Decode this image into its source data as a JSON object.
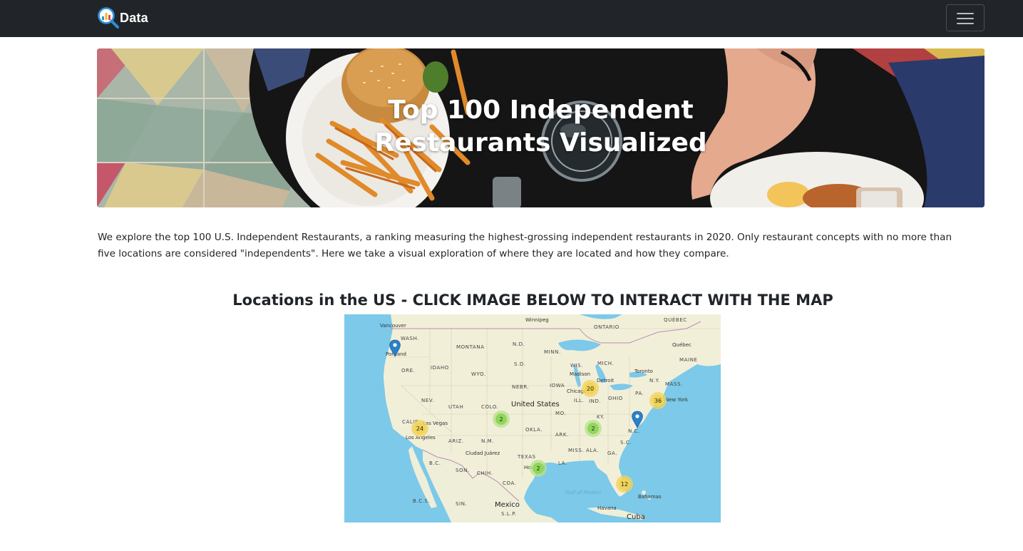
{
  "navbar": {
    "brand_text": "Data",
    "logo_icon": "magnifier-chart-icon",
    "toggler_icon": "hamburger-menu-icon"
  },
  "hero": {
    "title": "Top 100 Independent Restaurants Visualized"
  },
  "intro": {
    "text": "We explore the top 100 U.S. Independent Restaurants, a ranking measuring the highest-grossing independent restaurants in 2020. Only restaurant concepts with no more than five locations are considered \"independents\". Here we take a visual exploration of where they are located and how they compare."
  },
  "map_section": {
    "heading": "Locations in the US - CLICK IMAGE BELOW TO INTERACT WITH THE MAP",
    "country_label": "United States",
    "mexico_label": "Mexico",
    "cuba_label": "Cuba",
    "bahamas_label": "Bahamas",
    "havana_label": "Havana",
    "gulf_label": "Gulf of Mexico",
    "state_labels": [
      "WASH.",
      "ORE.",
      "IDAHO",
      "MONTANA",
      "WYO.",
      "NEV.",
      "UTAH",
      "CALIF.",
      "ARIZ.",
      "N.M.",
      "COLO.",
      "NEBR.",
      "S.D.",
      "N.D.",
      "MINN.",
      "IOWA",
      "WIS.",
      "MICH.",
      "ILL.",
      "IND.",
      "OHIO",
      "KY.",
      "MO.",
      "OKLA.",
      "ARK.",
      "TEXAS",
      "LA.",
      "MISS.",
      "ALA.",
      "GA.",
      "S.C.",
      "N.C.",
      "PA.",
      "N.Y.",
      "MASS.",
      "MAINE",
      "ONTARIO",
      "QUÉBEC",
      "B.C.S.",
      "SON.",
      "CHIH.",
      "COA.",
      "SIN.",
      "S.L.P.",
      "B.C."
    ],
    "city_labels": [
      "Vancouver",
      "Portland",
      "Las Vegas",
      "Los Angeles",
      "Ciudad Juárez",
      "Chicago",
      "Detroit",
      "Toronto",
      "New York",
      "Winnipeg",
      "Québec",
      "Madison",
      "Houston"
    ],
    "clusters": [
      {
        "count": "20",
        "level": "yellow"
      },
      {
        "count": "36",
        "level": "yellow"
      },
      {
        "count": "24",
        "level": "yellow"
      },
      {
        "count": "2",
        "level": "green"
      },
      {
        "count": "2",
        "level": "green"
      },
      {
        "count": "2",
        "level": "green"
      },
      {
        "count": "12",
        "level": "yellow"
      }
    ],
    "markers": [
      "Portland",
      "North Carolina"
    ]
  },
  "colors": {
    "navbar_bg": "#212529",
    "cluster_yellow": "#f1d357",
    "cluster_green": "#8fd65a",
    "marker_blue": "#2a81cb",
    "water": "#7cc9e9",
    "land": "#f2efd9"
  }
}
